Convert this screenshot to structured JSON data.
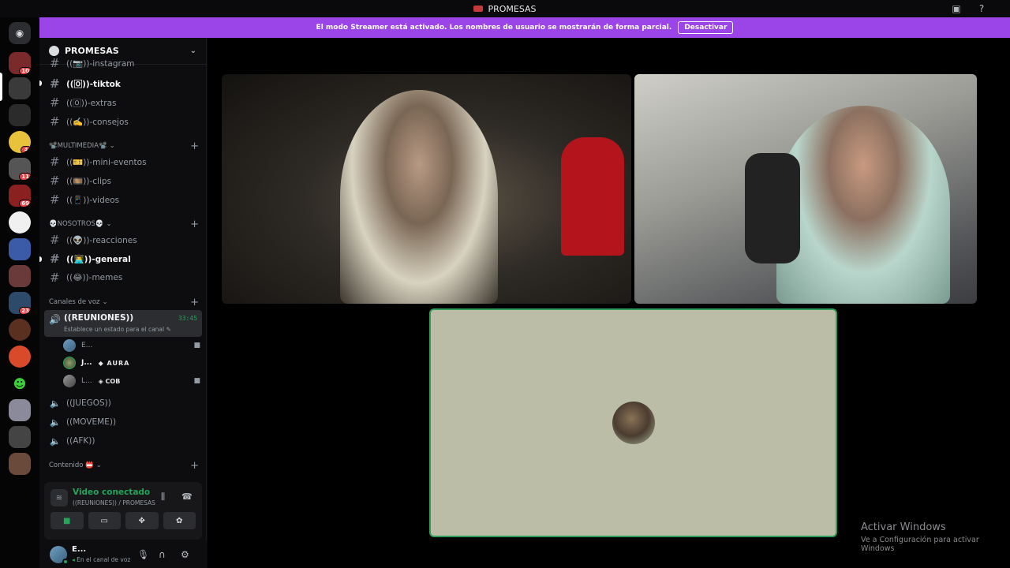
{
  "titlebar": {
    "title": "PROMESAS"
  },
  "banner": {
    "message": "El modo Streamer está activado. Los nombres de usuario se mostrarán de forma parcial.",
    "button": "Desactivar"
  },
  "server": {
    "name": "PROMESAS"
  },
  "channels": {
    "instagram": "((📷))-instagram",
    "tiktok": "((🄾))-tiktok",
    "extras": "((🄾))-extras",
    "consejos": "((✍️))-consejos",
    "cat_multimedia": "📽️MULTIMEDIA📽️",
    "mini_eventos": "((🎫))-mini-eventos",
    "clips": "((🎞️))-clips",
    "videos": "((📱))-videos",
    "cat_nosotros": "💀NOSOTROS💀",
    "reacciones": "((👽))-reacciones",
    "general": "((👨‍💻))-general",
    "memes": "((😂))-memes",
    "cat_voz": "Canales de voz",
    "reuniones": "((REUNIONES))",
    "reuniones_time": "33:45",
    "reuniones_status": "Establece un estado para el canal",
    "user1": "E...",
    "user2": "J...",
    "user2_tag": "AURA",
    "user3": "L...",
    "user3_tag": "COB",
    "juegos": "((JUEGOS))",
    "moveme": "((MOVEME))",
    "afk": "((AFK))",
    "cat_contenido": "Contenido 📛"
  },
  "rtc": {
    "status": "Video conectado",
    "location": "((REUNIONES)) / PROMESAS"
  },
  "userbar": {
    "name": "E...",
    "status": "En el canal de voz"
  },
  "server_badges": [
    "10",
    "4",
    "11",
    "69",
    "23"
  ],
  "watermark": {
    "line1": "Activar Windows",
    "line2": "Ve a Configuración para activar Windows"
  },
  "colors": {
    "accent_streamer": "#9b44e8",
    "connected_green": "#23a55a",
    "mention_red": "#f23f43"
  }
}
